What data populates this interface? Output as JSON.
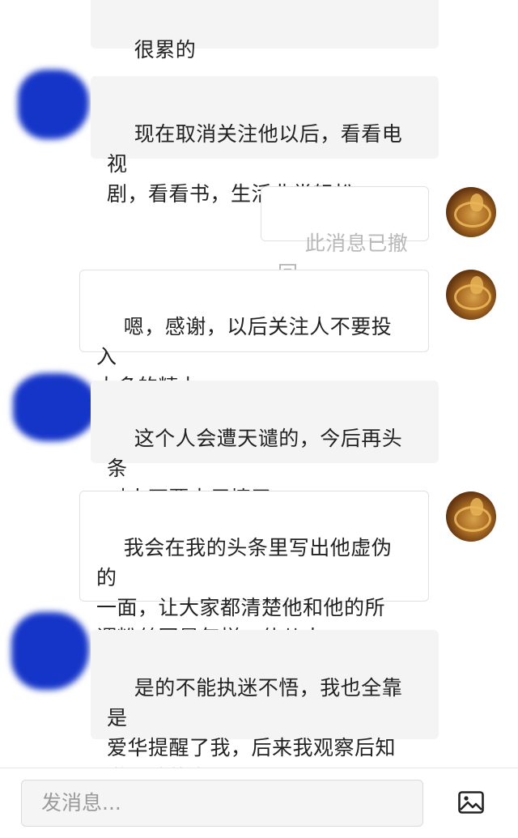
{
  "messages": [
    {
      "side": "left",
      "text": "很累的"
    },
    {
      "side": "left",
      "text": "现在取消关注他以后，看看电视\n剧，看看书，生活非常轻松，"
    },
    {
      "side": "right",
      "text": "此消息已撤回",
      "recalled": true
    },
    {
      "side": "right",
      "text": "嗯，感谢，以后关注人不要投入\n太多的精力"
    },
    {
      "side": "left",
      "text": "这个人会遭天谴的，今后再头条\n对人不要太用情了"
    },
    {
      "side": "right",
      "text": "我会在我的头条里写出他虚伪的\n一面，让大家都清楚他和他的所\n谓粉丝团是怎样一伙儿人"
    },
    {
      "side": "left",
      "text": "是的不能执迷不悟，我也全靠是\n爱华提醒了我，后来我观察后知\n道了他的为人。"
    }
  ],
  "composer": {
    "placeholder": "发消息...",
    "image_button_icon": "image-icon"
  },
  "colors": {
    "left_bubble": "#f4f4f4",
    "right_bubble_border": "#e1e1e1",
    "redaction_blue": "#1535c8",
    "recalled_text": "#b8b8b8"
  }
}
